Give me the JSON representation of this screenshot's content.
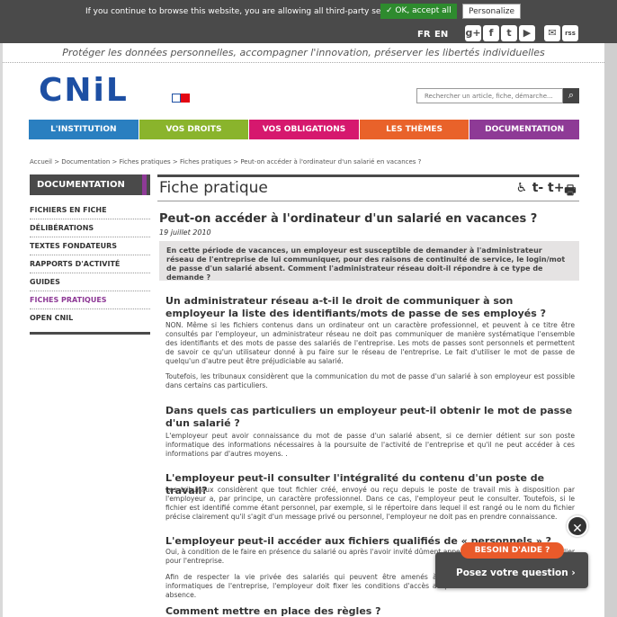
{
  "cookie": {
    "text": "If you continue to browse this website, you are allowing all third-party services",
    "accept_label": "✓ OK, accept all",
    "personalize_label": "Personalize"
  },
  "header": {
    "lang_fr": "FR",
    "lang_en": "EN",
    "social": [
      "g+",
      "f",
      "t",
      "▶",
      "✉",
      "rss"
    ],
    "tagline": "Protéger les données personnelles, accompagner l'innovation, préserver les libertés individuelles",
    "logo_text": "CNiL",
    "search_placeholder": "Rechercher un article, fiche, démarche..."
  },
  "nav": {
    "items": [
      {
        "label": "L'institution",
        "color": "#2a7fc0"
      },
      {
        "label": "Vos droits",
        "color": "#8ab42c"
      },
      {
        "label": "Vos obligations",
        "color": "#d6186e"
      },
      {
        "label": "Les thèmes",
        "color": "#e9622a"
      },
      {
        "label": "Documentation",
        "color": "#8e3a96"
      }
    ]
  },
  "breadcrumb": "Accueil > Documentation > Fiches pratiques > Fiches pratiques > Peut-on accéder à l'ordinateur d'un salarié en vacances ?",
  "sidebar": {
    "title": "DOCUMENTATION",
    "items": [
      {
        "label": "FICHIERS EN FICHE",
        "active": false
      },
      {
        "label": "DÉLIBÉRATIONS",
        "active": false
      },
      {
        "label": "TEXTES FONDATEURS",
        "active": false
      },
      {
        "label": "RAPPORTS D'ACTIVITÉ",
        "active": false
      },
      {
        "label": "GUIDES",
        "active": false
      },
      {
        "label": "FICHES PRATIQUES",
        "active": true
      },
      {
        "label": "OPEN CNIL",
        "active": false
      }
    ]
  },
  "main": {
    "section_title": "Fiche pratique",
    "tools": [
      "♿",
      "t-",
      "t+",
      "🖶"
    ],
    "article_title": "Peut-on accéder à l'ordinateur d'un salarié en vacances ?",
    "date": "19 juillet 2010",
    "chapo": "En cette période de vacances, un employeur est susceptible de demander à l'administrateur réseau de l'entreprise de lui communiquer, pour des raisons de continuité de service, le login/mot de passe d'un salarié absent. Comment l'administrateur réseau doit-il répondre à ce type de demande ?",
    "h1": "Un administrateur réseau a-t-il le droit de communiquer à son employeur la liste des identifiants/mots de passe de ses employés ?",
    "p1": "NON. Même si les fichiers contenus dans un ordinateur ont un caractère professionnel, et peuvent à ce titre être consultés par l'employeur, un administrateur réseau ne doit pas communiquer de manière systématique l'ensemble des identifiants et des mots de passe des salariés de l'entreprise. Les mots de passes sont personnels et permettent de savoir ce qu'un utilisateur donné à pu faire sur le réseau de l'entreprise. Le fait d'utiliser le mot de passe de quelqu'un d'autre peut être préjudiciable au salarié.",
    "p2": "Toutefois, les tribunaux considèrent que la communication du mot de passe d'un salarié à son employeur est possible dans certains cas particuliers.",
    "h2": "Dans quels cas particuliers un employeur peut-il obtenir le mot de passe d'un salarié ?",
    "p3": "L'employeur peut avoir connaissance du mot de passe d'un salarié absent, si ce dernier détient sur son poste informatique des informations nécessaires à la poursuite de l'activité de l'entreprise et qu'il ne peut accéder à ces informations par d'autres moyens. .",
    "h3": "L'employeur peut-il consulter l'intégralité du contenu d'un poste de travail?",
    "p4": "Les tribunaux considèrent que tout fichier créé, envoyé ou reçu depuis le poste de travail mis à disposition par l'employeur a, par principe, un caractère professionnel. Dans ce cas, l'employeur peut le consulter. Toutefois, si le fichier est identifié comme étant personnel, par exemple, si le répertoire dans lequel il est rangé ou le nom du fichier précise clairement qu'il s'agit d'un message privé ou personnel, l'employeur ne doit pas en prendre connaissance.",
    "h4": "L'employeur peut-il accéder aux fichiers qualifiés de « personnels » ?",
    "p5": "Oui, à condition de le faire en présence du salarié ou après l'avoir invité dûment appelé, ou en cas de risque particulier pour l'entreprise.",
    "p6": "Afin de respecter la vie privée des salariés qui peuvent être amenés à faire un usage personnel des outils informatiques de l'entreprise, l'employeur doit fixer les conditions d'accès au poste de travail des salariés en leur absence.",
    "h5": "Comment mettre en place des règles ?"
  },
  "help": {
    "badge": "BESOIN D'AIDE ?",
    "text": "Posez votre question ›",
    "close": "✕"
  }
}
